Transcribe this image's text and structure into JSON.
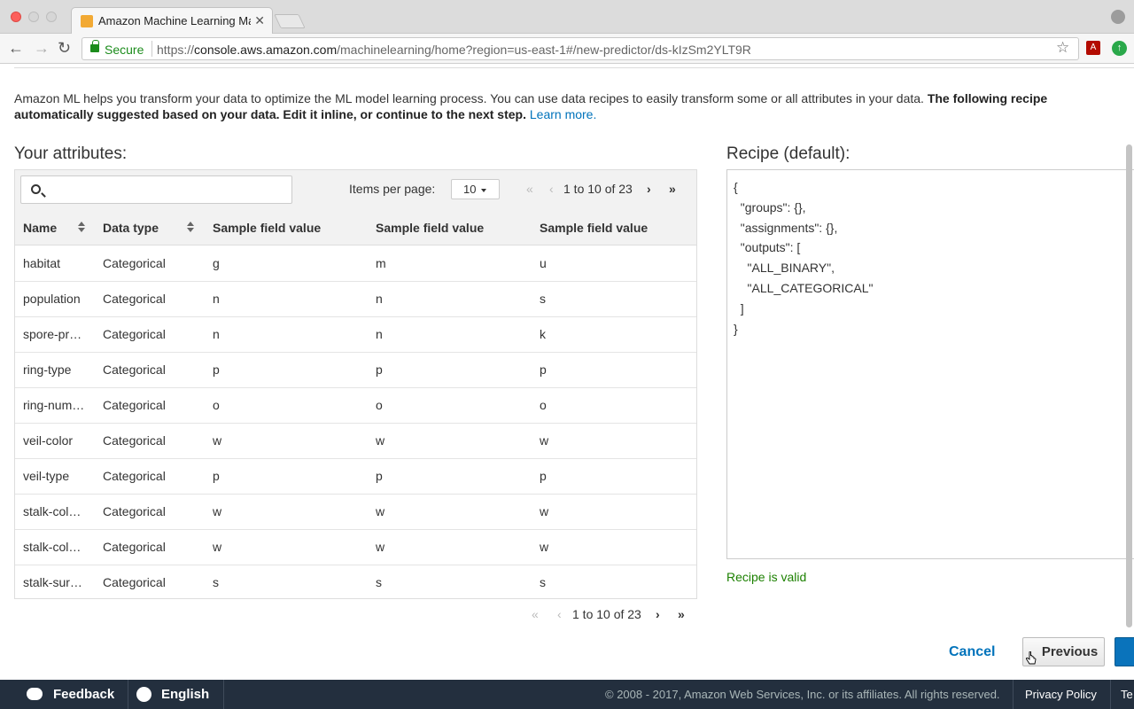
{
  "browser": {
    "tab_title": "Amazon Machine Learning Ma",
    "secure_label": "Secure",
    "url_scheme": "https://",
    "url_host": "console.aws.amazon.com",
    "url_path": "/machinelearning/home?region=us-east-1#/new-predictor/ds-kIzSm2YLT9R"
  },
  "intro": {
    "text": "Amazon ML helps you transform your data to optimize the ML model learning process. You can use data recipes to easily transform some or all attributes in your data. ",
    "bold_1": "The following recipe",
    "bold_2": "automatically suggested based on your data. Edit it inline, or continue to the next step.",
    "link": "Learn more."
  },
  "attributes": {
    "title": "Your attributes:",
    "search_placeholder": "",
    "items_per_page_label": "Items per page:",
    "items_per_page_value": "10",
    "pager": {
      "first": "«",
      "prev": "‹",
      "range": "1 to 10 of 23",
      "next": "›",
      "last": "»"
    },
    "columns": [
      "Name",
      "Data type",
      "Sample field value",
      "Sample field value",
      "Sample field value"
    ],
    "rows": [
      [
        "habitat",
        "Categorical",
        "g",
        "m",
        "u"
      ],
      [
        "population",
        "Categorical",
        "n",
        "n",
        "s"
      ],
      [
        "spore-pr…",
        "Categorical",
        "n",
        "n",
        "k"
      ],
      [
        "ring-type",
        "Categorical",
        "p",
        "p",
        "p"
      ],
      [
        "ring-num…",
        "Categorical",
        "o",
        "o",
        "o"
      ],
      [
        "veil-color",
        "Categorical",
        "w",
        "w",
        "w"
      ],
      [
        "veil-type",
        "Categorical",
        "p",
        "p",
        "p"
      ],
      [
        "stalk-col…",
        "Categorical",
        "w",
        "w",
        "w"
      ],
      [
        "stalk-col…",
        "Categorical",
        "w",
        "w",
        "w"
      ],
      [
        "stalk-sur…",
        "Categorical",
        "s",
        "s",
        "s"
      ]
    ]
  },
  "recipe": {
    "title": "Recipe (default):",
    "text": "{\n  \"groups\": {},\n  \"assignments\": {},\n  \"outputs\": [\n    \"ALL_BINARY\",\n    \"ALL_CATEGORICAL\"\n  ]\n}",
    "status": "Recipe is valid"
  },
  "actions": {
    "cancel": "Cancel",
    "previous": "Previous"
  },
  "footer": {
    "feedback": "Feedback",
    "language": "English",
    "copyright": "© 2008 - 2017, Amazon Web Services, Inc. or its affiliates. All rights reserved.",
    "privacy": "Privacy Policy",
    "terms": "Te"
  },
  "colors": {
    "link": "#0073bb",
    "valid": "#1d8102",
    "footer_bg": "#232f3e",
    "primary_button": "#0a73bb"
  }
}
